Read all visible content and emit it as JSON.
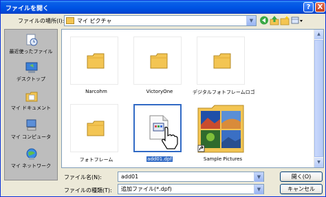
{
  "window": {
    "title": "ファイルを開く",
    "help_glyph": "?",
    "close_glyph": "X"
  },
  "toolbar": {
    "look_in_label": "ファイルの場所(I):",
    "look_in_value": "マイ ピクチャ",
    "dropdown_glyph": "▼"
  },
  "places": [
    {
      "label": "最近使ったファイル",
      "icon": "recent-documents-icon"
    },
    {
      "label": "デスクトップ",
      "icon": "desktop-icon"
    },
    {
      "label": "マイ ドキュメント",
      "icon": "my-documents-icon"
    },
    {
      "label": "マイ コンピュータ",
      "icon": "my-computer-icon"
    },
    {
      "label": "マイ ネットワーク",
      "icon": "my-network-icon"
    }
  ],
  "files": [
    {
      "name": "Narcohm",
      "type": "folder"
    },
    {
      "name": "VictoryOne",
      "type": "folder"
    },
    {
      "name": "デジタルフォトフレームロゴ",
      "type": "folder"
    },
    {
      "name": "フォトフレーム",
      "type": "folder"
    },
    {
      "name": "add01.dpf",
      "type": "file",
      "selected": true
    },
    {
      "name": "Sample Pictures",
      "type": "shortcut-folder"
    }
  ],
  "bottom": {
    "filename_label": "ファイル名(N):",
    "filename_value": "add01",
    "filetype_label": "ファイルの種類(T):",
    "filetype_value": "追加ファイル(*.dpf)",
    "open_label": "開く(O)",
    "cancel_label": "キャンセル"
  },
  "colors": {
    "titlebar": "#0055e5",
    "selection": "#316ac5",
    "folder": "#f3c553"
  }
}
